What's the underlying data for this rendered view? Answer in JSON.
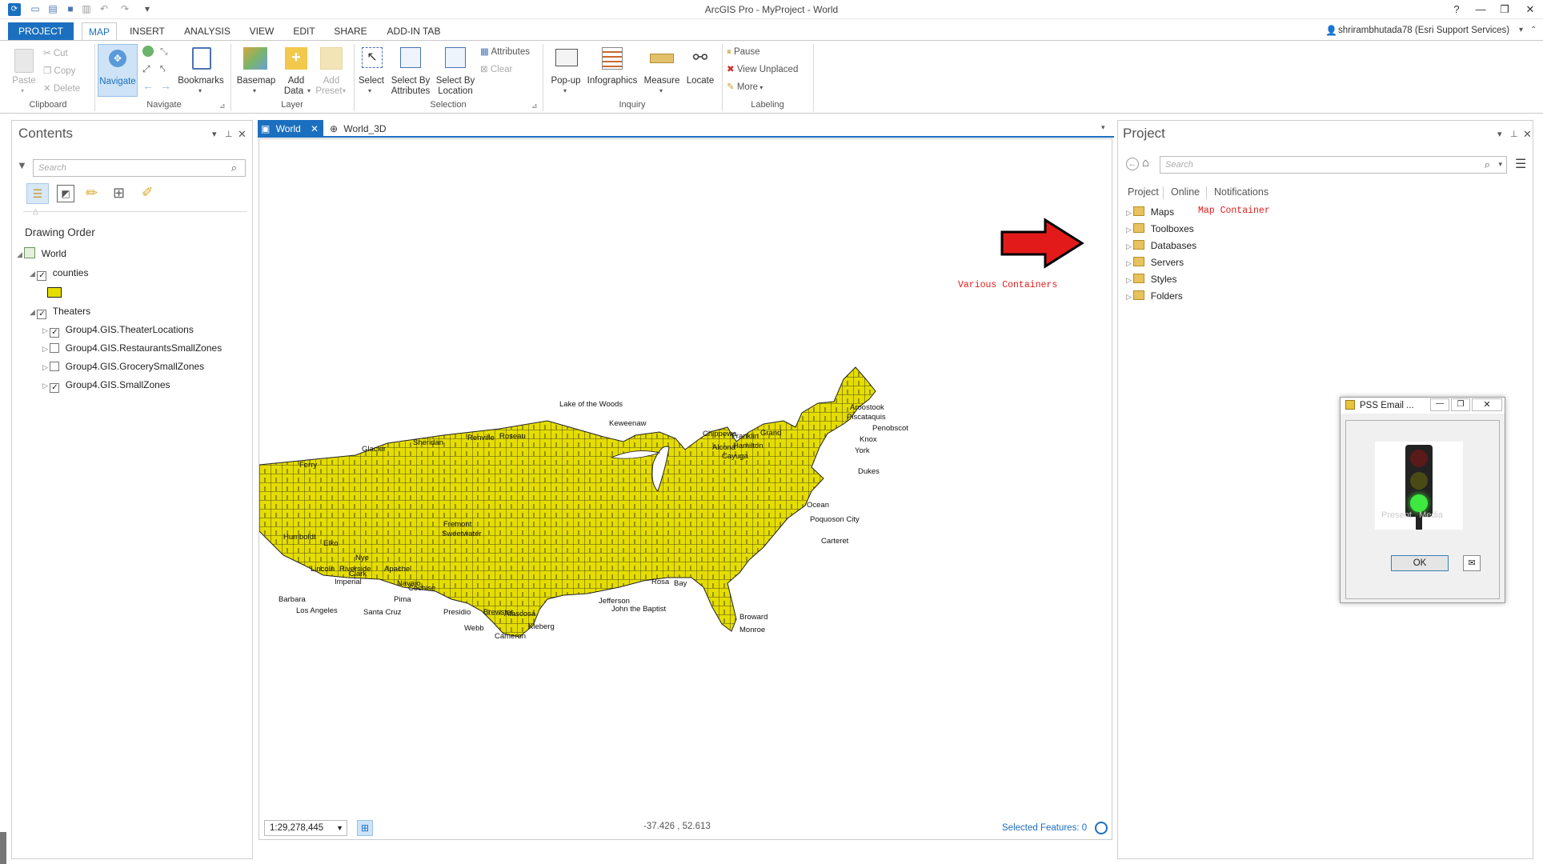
{
  "window": {
    "title": "ArcGIS Pro - MyProject - World",
    "help": "?",
    "minimize": "—",
    "restore": "❐",
    "close": "✕"
  },
  "tabs": [
    {
      "label": "PROJECT"
    },
    {
      "label": "MAP"
    },
    {
      "label": "INSERT"
    },
    {
      "label": "ANALYSIS"
    },
    {
      "label": "VIEW"
    },
    {
      "label": "EDIT"
    },
    {
      "label": "SHARE"
    },
    {
      "label": "ADD-IN TAB"
    }
  ],
  "user": "shrirambhutada78 (Esri Support Services)",
  "ribbon": {
    "clipboard": {
      "label": "Clipboard",
      "paste": "Paste",
      "cut": "Cut",
      "copy": "Copy",
      "delete": "Delete"
    },
    "navigate": {
      "label": "Navigate",
      "navigate": "Navigate",
      "bookmarks": "Bookmarks"
    },
    "layer": {
      "label": "Layer",
      "basemap": "Basemap",
      "add_data_1": "Add",
      "add_data_2": "Data",
      "add_preset_1": "Add",
      "add_preset_2": "Preset"
    },
    "selection": {
      "label": "Selection",
      "select": "Select",
      "sba_1": "Select By",
      "sba_2": "Attributes",
      "sbl_1": "Select By",
      "sbl_2": "Location",
      "attributes": "Attributes",
      "clear": "Clear"
    },
    "inquiry": {
      "label": "Inquiry",
      "popup": "Pop-up",
      "infographics": "Infographics",
      "measure": "Measure",
      "locate": "Locate"
    },
    "labeling": {
      "label": "Labeling",
      "pause": "Pause",
      "view_unplaced": "View Unplaced",
      "more": "More"
    }
  },
  "contents": {
    "title": "Contents",
    "search_placeholder": "Search",
    "drawing_order": "Drawing Order",
    "map_name": "World",
    "layers": [
      {
        "name": "counties",
        "checked": true
      },
      {
        "name": "Theaters",
        "checked": true
      }
    ],
    "sublayers": [
      {
        "name": "Group4.GIS.TheaterLocations",
        "checked": true
      },
      {
        "name": "Group4.GIS.RestaurantsSmallZones",
        "checked": false
      },
      {
        "name": "Group4.GIS.GrocerySmallZones",
        "checked": false
      },
      {
        "name": "Group4.GIS.SmallZones",
        "checked": true
      }
    ],
    "fill_color": "#e5dd00"
  },
  "map_tabs": [
    {
      "label": "World"
    },
    {
      "label": "World_3D"
    }
  ],
  "map": {
    "annotation_various": "Various Containers",
    "scale": "1:29,278,445",
    "coordinates": "-37.426 , 52.613",
    "selected_features": "Selected Features: 0",
    "county_color": "#e5dd00",
    "arrow_color": "#e21a1a",
    "labels": [
      "Lake of the Woods",
      "Keweenaw",
      "Sheridan",
      "Renville",
      "Roseau",
      "Glacier",
      "Ferry",
      "Chippewa",
      "Alcona",
      "Aroostook",
      "Piscataquis",
      "Penobscot",
      "Franklin",
      "Grand",
      "Hamilton",
      "Cayuga",
      "Knox",
      "York",
      "Dukes",
      "Ocean",
      "Poquoson City",
      "Carteret",
      "Barbara",
      "Los Angeles",
      "Santa Cruz",
      "Brewster",
      "Webb",
      "Cameron",
      "Kleberg",
      "John the Baptist",
      "Jefferson",
      "Rosa",
      "Bay",
      "Broward",
      "Monroe",
      "Fremont",
      "Sweetwater",
      "Elko",
      "Nye",
      "Pima",
      "Cochise",
      "Humboldt",
      "Lincoln",
      "Clark",
      "Apache",
      "Navajo",
      "Imperial",
      "Riverside",
      "Presidio",
      "Atascosa"
    ]
  },
  "project": {
    "title": "Project",
    "search_placeholder": "Search",
    "nav_tabs": [
      "Project",
      "Online",
      "Notifications"
    ],
    "items": [
      "Maps",
      "Toolboxes",
      "Databases",
      "Servers",
      "Styles",
      "Folders"
    ],
    "annotation_map_container": "Map Container"
  },
  "dialog": {
    "title": "PSS Email ...",
    "ok": "OK",
    "watermark": "Present   Media"
  }
}
